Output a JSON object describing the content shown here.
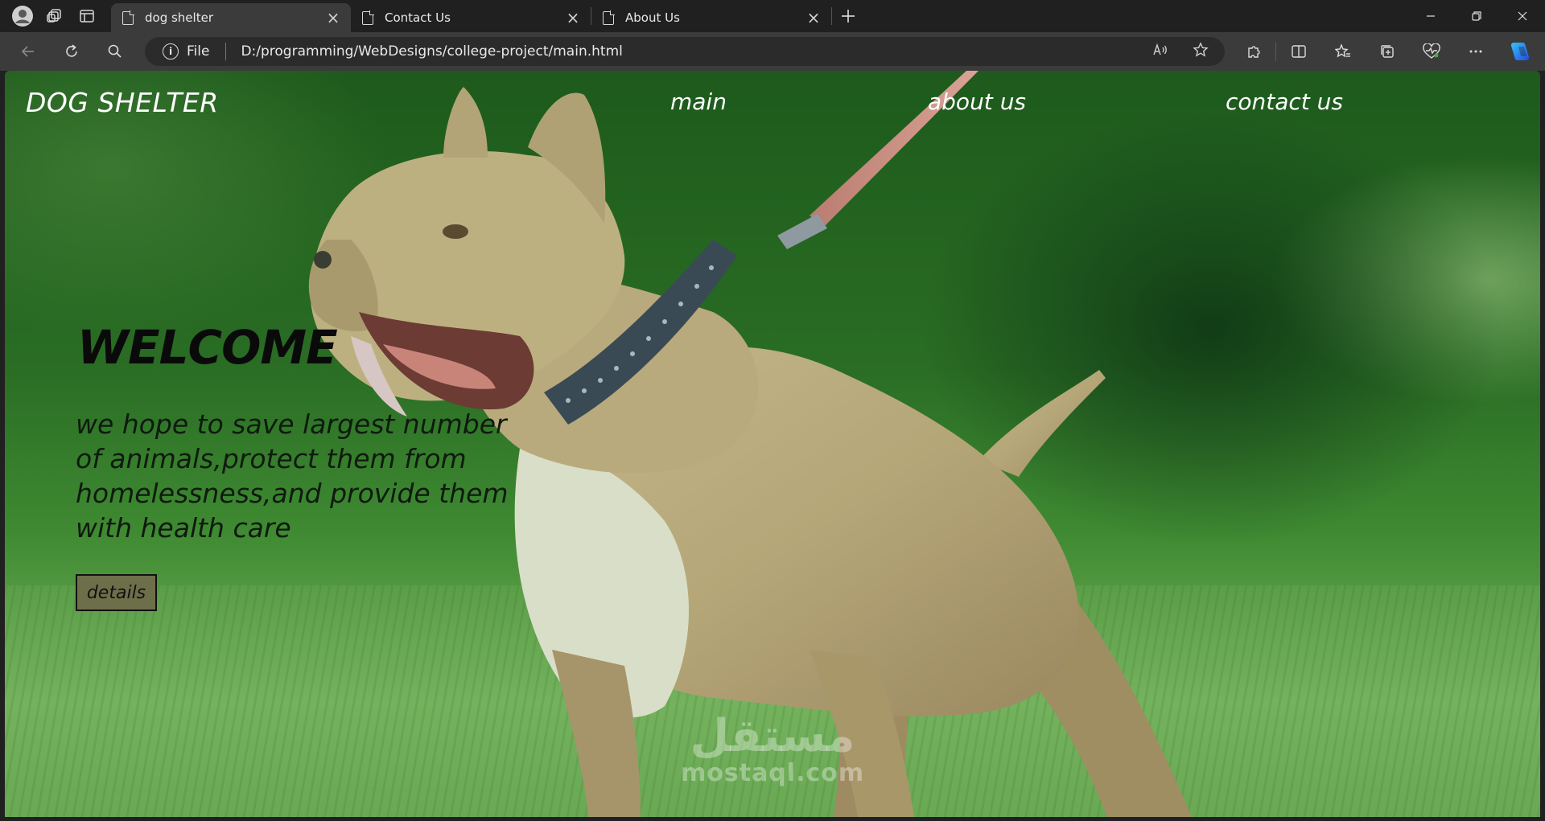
{
  "browser": {
    "tabs": [
      {
        "title": "dog shelter",
        "active": true
      },
      {
        "title": "Contact Us",
        "active": false
      },
      {
        "title": "About Us",
        "active": false
      }
    ],
    "address": {
      "scheme_label": "File",
      "url": "D:/programming/WebDesigns/college-project/main.html"
    },
    "icons": {
      "profile": "profile-avatar-icon",
      "workspaces": "workspaces-icon",
      "tab_actions": "tab-actions-icon",
      "back": "back-arrow-icon",
      "refresh": "refresh-icon",
      "search": "search-icon",
      "info": "info-icon",
      "read_aloud": "read-aloud-icon",
      "favorite": "star-icon",
      "extensions": "puzzle-icon",
      "split_screen": "split-screen-icon",
      "favorites": "favorites-icon",
      "collections": "collections-icon",
      "browser_essentials": "heart-pulse-icon",
      "more": "more-dots-icon",
      "copilot": "copilot-icon"
    }
  },
  "site": {
    "logo": "DOG SHELTER",
    "nav": [
      "main",
      "about us",
      "contact us"
    ],
    "hero_title": "WELCOME",
    "hero_lines": [
      "we hope to save largest number",
      "of animals,protect them from",
      "homelessness,and provide them",
      "with health care"
    ],
    "details_label": "details"
  },
  "watermark": {
    "arabic": "مستقل",
    "latin": "mostaql.com"
  },
  "colors": {
    "chrome_bg": "#202020",
    "toolbar_bg": "#3b3b3b",
    "button_bg": "#6c6f4a",
    "page_green": "#2a6d24"
  }
}
